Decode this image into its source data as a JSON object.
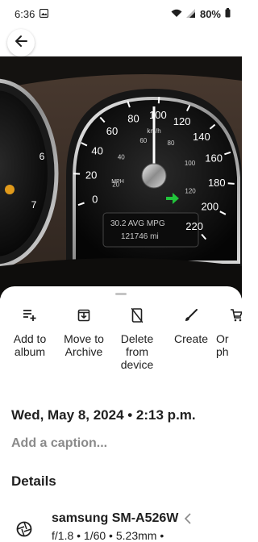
{
  "status": {
    "time": "6:36",
    "battery": "80%"
  },
  "photo": {
    "speed_ticks": [
      "0",
      "20",
      "40",
      "60",
      "80",
      "100",
      "120",
      "140",
      "160",
      "180",
      "200",
      "220"
    ],
    "mph_label": "MPH",
    "kmh_label": "km/h",
    "inner_ticks": [
      "20",
      "40",
      "60",
      "80",
      "100",
      "120"
    ],
    "lcd_line1": "30.2 AVG MPG",
    "lcd_line2": "121746 mi"
  },
  "actions": [
    {
      "label": "Add to album",
      "icon": "add-to-playlist-icon"
    },
    {
      "label": "Move to Archive",
      "icon": "archive-icon"
    },
    {
      "label": "Delete from device",
      "icon": "delete-from-device-icon"
    },
    {
      "label": "Create",
      "icon": "brush-icon"
    },
    {
      "label": "Or ph",
      "icon": "cart-icon"
    }
  ],
  "date": "Wed, May 8, 2024 • 2:13 p.m.",
  "caption_placeholder": "Add a caption...",
  "details_heading": "Details",
  "device": {
    "name": "samsung SM-A526W",
    "spec": "f/1.8 • 1/60 • 5.23mm •"
  }
}
